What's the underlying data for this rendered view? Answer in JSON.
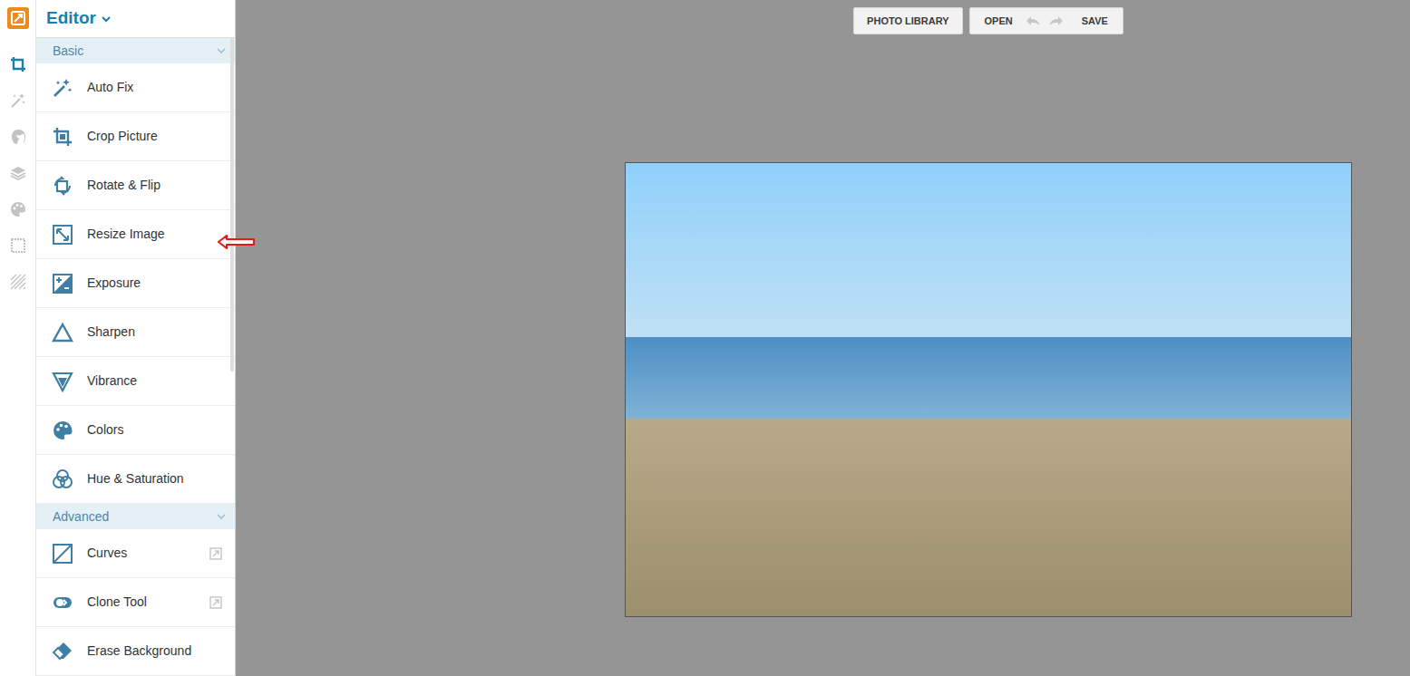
{
  "app": {
    "title": "Editor"
  },
  "rail": [
    {
      "selected": true
    },
    {
      "selected": false
    },
    {
      "selected": false
    },
    {
      "selected": false
    },
    {
      "selected": false
    },
    {
      "selected": false
    },
    {
      "selected": false
    }
  ],
  "sections": [
    {
      "label": "Basic",
      "expanded": true,
      "items": [
        {
          "label": "Auto Fix",
          "premium": false
        },
        {
          "label": "Crop Picture",
          "premium": false
        },
        {
          "label": "Rotate & Flip",
          "premium": false
        },
        {
          "label": "Resize Image",
          "premium": false
        },
        {
          "label": "Exposure",
          "premium": false
        },
        {
          "label": "Sharpen",
          "premium": false
        },
        {
          "label": "Vibrance",
          "premium": false
        },
        {
          "label": "Colors",
          "premium": false
        },
        {
          "label": "Hue & Saturation",
          "premium": false
        }
      ]
    },
    {
      "label": "Advanced",
      "expanded": true,
      "items": [
        {
          "label": "Curves",
          "premium": true
        },
        {
          "label": "Clone Tool",
          "premium": true
        },
        {
          "label": "Erase Background",
          "premium": false
        }
      ]
    }
  ],
  "toolbar": {
    "library": "PHOTO LIBRARY",
    "open": "OPEN",
    "undo_disabled": true,
    "redo_disabled": true,
    "save": "SAVE"
  }
}
